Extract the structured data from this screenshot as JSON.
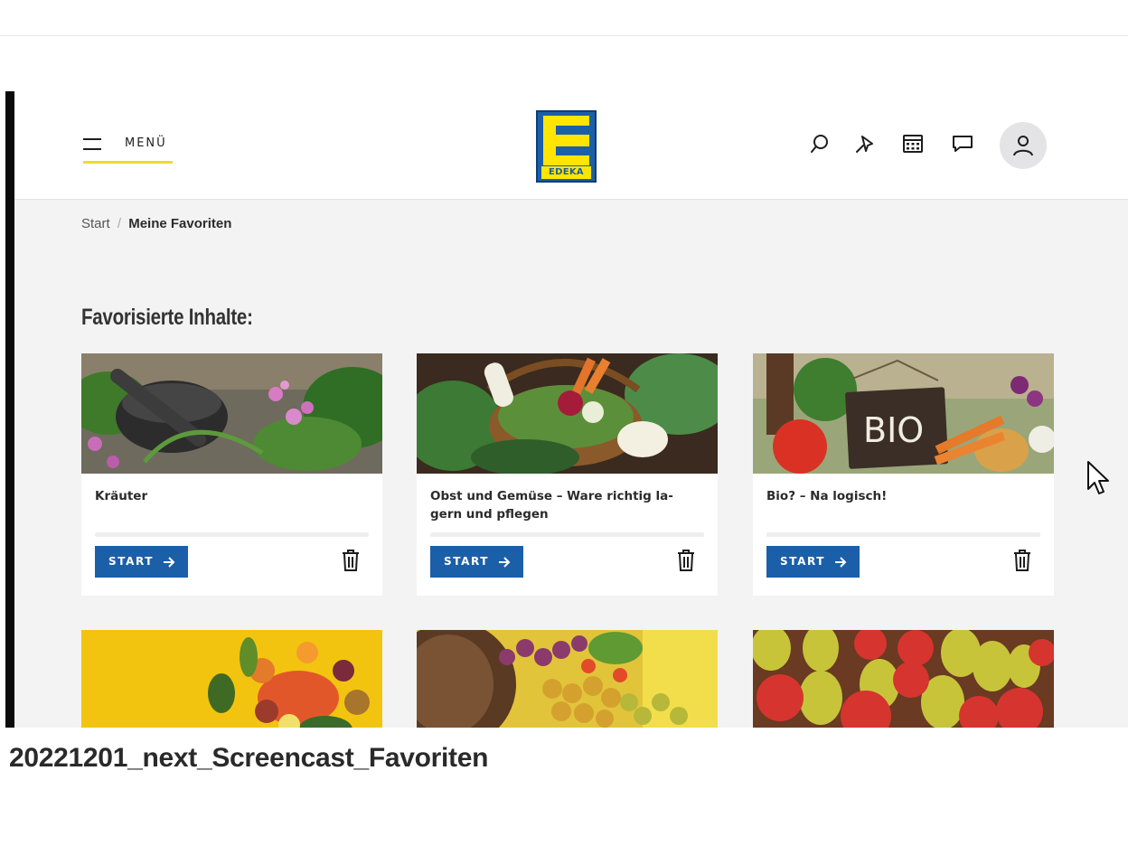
{
  "header": {
    "menu_label": "MENÜ",
    "logo_text": "EDEKA",
    "icons": [
      "search-icon",
      "pin-icon",
      "calendar-icon",
      "chat-icon",
      "user-icon"
    ]
  },
  "breadcrumb": {
    "home": "Start",
    "separator": "/",
    "current": "Meine Favoriten"
  },
  "section_title": "Favorisierte Inhalte:",
  "cards": [
    {
      "title": "Kräuter",
      "button": "START",
      "progress": 0
    },
    {
      "title": "Obst und Gemüse – Ware richtig la-gern und pflegen",
      "button": "START",
      "progress": 0
    },
    {
      "title": "Bio? – Na logisch!",
      "button": "START",
      "progress": 0
    }
  ],
  "caption": "20221201_next_Screencast_Favoriten",
  "colors": {
    "brand_blue": "#1b5fa8",
    "brand_yellow": "#ffe500",
    "menu_underline": "#e8df2b",
    "page_bg": "#f3f3f4"
  }
}
